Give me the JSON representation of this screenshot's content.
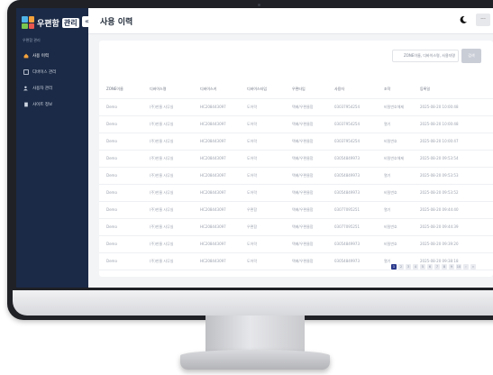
{
  "sidebar": {
    "logo_text": "우편함",
    "logo_badge": "관리",
    "section_label": "우편함 관리",
    "items": [
      {
        "label": "사용 이력",
        "icon": "home-icon",
        "active": true
      },
      {
        "label": "디바이스 관리",
        "icon": "device-icon",
        "active": false
      },
      {
        "label": "사용자 관리",
        "icon": "users-icon",
        "active": false
      },
      {
        "label": "사이트 정보",
        "icon": "building-icon",
        "active": false
      }
    ]
  },
  "header": {
    "title": "사용 이력",
    "collapse_glyph": "«",
    "user_glyph": "···"
  },
  "search": {
    "placeholder": "ZONE이름, 디바이스명, 사용자명",
    "button_label": "검색"
  },
  "table": {
    "columns": [
      "ZONE이름",
      "디바이스명",
      "디바이스키",
      "디바이스타입",
      "우편타입",
      "사용자",
      "조작",
      "등록일"
    ],
    "rows": [
      [
        "Demo",
        "(주)한울 사무실",
        "HC208443097",
        "도어락",
        "택배/우편물함",
        "03037954254",
        "비밀번호해제",
        "2025-08-20 10:00:48"
      ],
      [
        "Demo",
        "(주)한울 사무실",
        "HC208443097",
        "도어락",
        "택배/우편물함",
        "03037954254",
        "열기",
        "2025-08-20 10:00:48"
      ],
      [
        "Demo",
        "(주)한울 사무실",
        "HC208443097",
        "도어락",
        "택배/우편물함",
        "03037954254",
        "비밀번호",
        "2025-08-20 10:00:47"
      ],
      [
        "Demo",
        "(주)한울 사무실",
        "HC208443097",
        "도어락",
        "택배/우편물함",
        "03054849973",
        "비밀번호해제",
        "2025-08-20 09:53:54"
      ],
      [
        "Demo",
        "(주)한울 사무실",
        "HC208443097",
        "도어락",
        "택배/우편물함",
        "03054849973",
        "열기",
        "2025-08-20 09:53:53"
      ],
      [
        "Demo",
        "(주)한울 사무실",
        "HC208443097",
        "도어락",
        "택배/우편물함",
        "03054849973",
        "비밀번호",
        "2025-08-20 09:53:52"
      ],
      [
        "Demo",
        "(주)한울 사무실",
        "HC208443097",
        "우편함",
        "택배/우편물함",
        "03077095251",
        "열기",
        "2025-08-20 09:44:40"
      ],
      [
        "Demo",
        "(주)한울 사무실",
        "HC208443097",
        "우편함",
        "택배/우편물함",
        "03077095251",
        "비밀번호",
        "2025-08-20 09:44:39"
      ],
      [
        "Demo",
        "(주)한울 사무실",
        "HC208443097",
        "도어락",
        "택배/우편물함",
        "03054849973",
        "비밀번호",
        "2025-08-20 09:39:20"
      ],
      [
        "Demo",
        "(주)한울 사무실",
        "HC208443097",
        "도어락",
        "택배/우편물함",
        "03054849973",
        "열기",
        "2025-08-20 09:38:18"
      ]
    ]
  },
  "pagination": {
    "pages": [
      "1",
      "2",
      "3",
      "4",
      "5",
      "6",
      "7",
      "8",
      "9",
      "10",
      "›",
      "»"
    ],
    "current": "1"
  },
  "colors": {
    "sidebar_bg": "#1b2a46",
    "accent": "#2b3a8c",
    "active_icon": "#f3a23c"
  }
}
